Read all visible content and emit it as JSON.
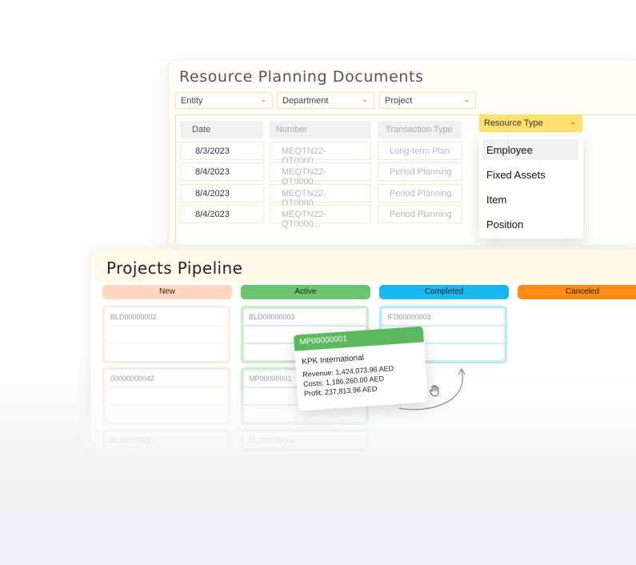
{
  "resource_planning": {
    "title": "Resource Planning Documents",
    "filters": [
      "Entity",
      "Department",
      "Project"
    ],
    "columns": [
      "Date",
      "Number",
      "Transaction Type"
    ],
    "rows": [
      {
        "date": "8/3/2023",
        "number": "MEQTN22-QT0000...",
        "type": "Long-term Plan"
      },
      {
        "date": "8/4/2023",
        "number": "MEQTN22-QT0000...",
        "type": "Period Planning"
      },
      {
        "date": "8/4/2023",
        "number": "MEQTN22-QT0000...",
        "type": "Period Planning"
      },
      {
        "date": "8/4/2023",
        "number": "MEQTN22-QT0000...",
        "type": "Period Planning"
      }
    ],
    "resource_type": {
      "label": "Resource Type",
      "options": [
        "Employee",
        "Fixed Assets",
        "Item",
        "Position"
      ],
      "highlighted": "Employee"
    }
  },
  "pipeline": {
    "title": "Projects Pipeline",
    "columns": [
      {
        "label": "New",
        "color": "#ffd7bd"
      },
      {
        "label": "Active",
        "color": "#6cc570"
      },
      {
        "label": "Completed",
        "color": "#19b7ee"
      },
      {
        "label": "Canceled",
        "color": "#ff8c16"
      }
    ],
    "new_cards": [
      "BLD00000002",
      "00000000042",
      "BLD00000001"
    ],
    "active_cards": [
      "BLD00000003",
      "MP00000001",
      "BLD00000004"
    ],
    "completed_cards": [
      "IFD00000003"
    ],
    "dragged_card": {
      "id": "MP00000001",
      "company": "KPK International",
      "revenue": "Revenue: 1,424,073.96 AED",
      "costs": "Costs: 1,186,260.00 AED",
      "profit": "Profit: 237,813.96 AED"
    }
  },
  "icons": {
    "chevron": "chevron-down-icon",
    "hand": "hand-cursor-icon",
    "arrow": "drag-arrow-icon"
  }
}
